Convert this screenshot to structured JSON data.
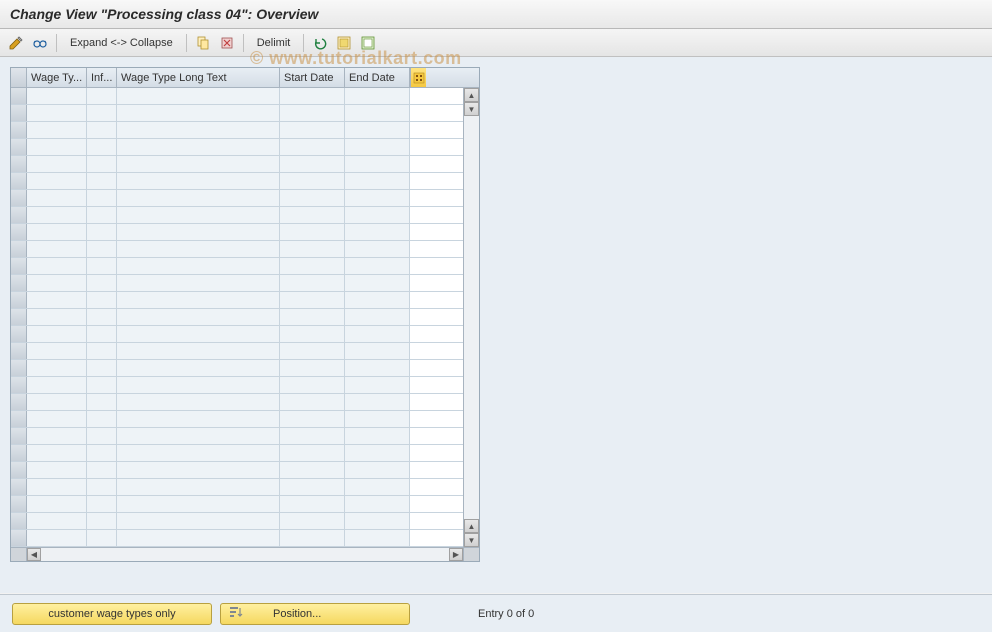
{
  "title": "Change View \"Processing class 04\": Overview",
  "toolbar": {
    "expand_collapse": "Expand <-> Collapse",
    "delimit": "Delimit"
  },
  "grid": {
    "columns": {
      "wage_ty": "Wage Ty...",
      "inf": "Inf...",
      "long_text": "Wage Type Long Text",
      "start_date": "Start Date",
      "end_date": "End Date"
    },
    "row_count": 27
  },
  "footer": {
    "customer_wage": "customer wage types only",
    "position": "Position...",
    "entry": "Entry 0 of 0"
  },
  "watermark": "© www.tutorialkart.com"
}
